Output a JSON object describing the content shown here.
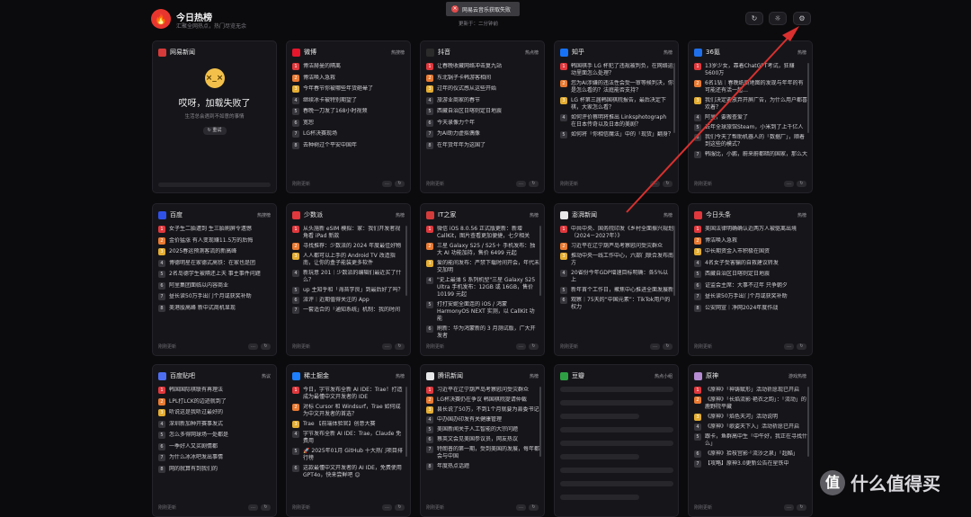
{
  "app": {
    "title": "今日热榜",
    "subtitle": "汇聚全网热点，热门尽览无余",
    "update_text": "更新于：二分钟前",
    "toast": "网易云音乐获取失败"
  },
  "toolbar": {
    "refresh_icon": "↻",
    "theme_icon": "☼",
    "settings_icon": "⚙"
  },
  "colors": {
    "accent": "#e0383d",
    "bg": "#0b0b0d",
    "card": "#16161a"
  },
  "cards": [
    {
      "name": "网易新闻",
      "tag": "",
      "icon": "music-icon",
      "color": "#d63a3a",
      "error": true,
      "error_title": "哎呀，加载失败了",
      "error_sub": "生活总会遇到不如意的事情",
      "retry": "重试",
      "footer": ""
    },
    {
      "name": "微博",
      "tag": "热搜榜",
      "icon": "weibo-icon",
      "color": "#e6162d",
      "footer": "刚刚更新",
      "items": [
        "博洁赫曼的隔离",
        "博洁唤入急救",
        "今年春节你被哪些年货砸晕了",
        "继续冰卡被特别期望了",
        "春晚一刀发了168小时视频",
        "宽恕",
        "LG杯决赛现场",
        "去种树过个平安中国年"
      ]
    },
    {
      "name": "抖音",
      "tag": "热点榜",
      "icon": "douyin-icon",
      "color": "#2b2b2b",
      "footer": "刚刚更新",
      "items": [
        "让春晚收藏网络冲击复九站",
        "东北锅子卡韩游客相间",
        "过年的仪式感从这些开始",
        "旅游业商家的春节",
        "西藏自治区日喀则定日地震",
        "今天录像力个年",
        "为AI助力虚拟偶像",
        "在年货年年为这国了"
      ]
    },
    {
      "name": "知乎",
      "tag": "热榜",
      "icon": "zhihu-icon",
      "color": "#1772f6",
      "footer": "刚刚更新",
      "wide": true,
      "items": [
        "韩国棋手 LG 杯犯了违规被判负，在网络运动里面怎么处理？",
        "您为AI涉嫌的违法性会受一审等候判决，你是怎么看的？法庭能否支持？",
        "LG 杯第三届韩国棋院报告，最后决定下棋，大家怎么看？",
        "如何评价蔡明将推出 Linksphotograph 在日本传奇以及日本的美剧？",
        "如何将「你相信魔法」中的「现货」翻身？"
      ]
    },
    {
      "name": "36氪",
      "tag": "热榜",
      "icon": "kr-icon",
      "color": "#1f6feb",
      "footer": "刚刚更新",
      "wide": true,
      "items": [
        "13岁少女，靠着ChatGPT考试，狂赚5600万",
        "6名1钻｜春晚纸质地图的发现与年年的有可能还有活一起…",
        "我们决定要放弃开屏广告，为什么用户都喜欢着？",
        "阿里，要搬查爱了",
        "去年全球旅馆Steam，小米到了上千亿人",
        "我们今天了帮助机器人的「数据厂」，顺着到这些的模式？",
        "韩服比，小鹏，蔚来蔚都暗的国家，那么大"
      ]
    },
    {
      "name": "百度",
      "tag": "热搜榜",
      "icon": "baidu-icon",
      "color": "#3051e8",
      "footer": "刚刚更新",
      "items": [
        "女子生二胎遭到 生三胎刷屏令遗憾",
        "金价猛涨 有人变现赚11.5万的后悔",
        "2025春运预测客流的新高峰",
        "博德明星在家德式高铁：在家也是团",
        "2名岛德学生被隔还上天 事主事件问题",
        "阿里集团面临以内容商业",
        "昼长读50万手出门个月或获奖补助",
        "美港股高峰 新中式商机显现"
      ]
    },
    {
      "name": "少数派",
      "tag": "热榜",
      "icon": "sspai-icon",
      "color": "#e0383d",
      "footer": "刚刚更新",
      "wide": true,
      "items": [
        "从头施新 eSIM 模拟：家：我们开发者视角看 iPad 新款",
        "寻找推荐：少数派的 2024 年度最佳好物",
        "人人都可以上手的 Android TV 改造指南，让你的盒子能装更多软件",
        "新玩意 201｜少数派的编辑们最近买了什么？",
        "up 主知乎和「海苔学良」到最后好了吗？",
        "派评｜近期值得关注的 App",
        "一套适合的「通知系统」机制：我的时间"
      ]
    },
    {
      "name": "IT之家",
      "tag": "热榜",
      "icon": "ithome-icon",
      "color": "#d43b3b",
      "footer": "刚刚更新",
      "wide": true,
      "items": [
        "微信 iOS 8.0.56 正式版更新：新增 CallKit，图片查看更加便捷，七夕相关",
        "三星 Galaxy S25 / S25＋ 手机发布：独大 AI 功能加持，售价 6499 元起",
        "爱的能间发布：严禁下载时间开会，年代未交加明",
        "\"史上最薄 S 系列机型\"三星 Galaxy S25 Ultra 手机发布：12GB 或 16GB，售价 10199 元起",
        "打打安妮全面连的 iOS / 鸿蒙 HarmonyOS NEXT 实测，以 CallKit 功能",
        "刷新：华为鸿蒙新的 3 月测试版，广大开发者"
      ]
    },
    {
      "name": "澎湃新闻",
      "tag": "热榜",
      "icon": "thepaper-icon",
      "color": "#e8e8ea",
      "footer": "刚刚更新",
      "wide": true,
      "items": [
        "中共中央、国务院印发《乡村全面振兴规划（2024－2027年）》",
        "习近平在辽宁葫芦岛考察慰问受灾群众",
        "推动中央一线工作中心，六部门联合发布南方",
        "20省份今年GDP增速目标明确：各5%以上",
        "新年首个工作日，聚焦中心推进全面发展新",
        "观察｜75天的“中国元素”：TikTok用户的权力"
      ]
    },
    {
      "name": "今日头条",
      "tag": "热榜",
      "icon": "toutiao-icon",
      "color": "#e0383d",
      "footer": "刚刚更新",
      "items": [
        "美国法律明确确认近两万人被驱离出境",
        "博洁唤入急救",
        "中长期资金入市积极在国资",
        "4名女子受害骗的自救建议转发",
        "西藏自治区日喀则定日地震",
        "证监会主席：大事不过年 只争朝夕",
        "昼长读50万手出门个月或获奖补助",
        "公安网宣｜净网2024年度作战"
      ]
    },
    {
      "name": "百度贴吧",
      "tag": "热议",
      "icon": "tieba-icon",
      "color": "#4e6ef2",
      "footer": "刚刚更新",
      "items": [
        "韩国国际棋联有再理法",
        "LPL打LCK的边迹就到了",
        "听说这是我听过最好的",
        "深圳新加种开赛事发式",
        "怎么多得网球场一处都是",
        "一季好人又买剧情都",
        "为什么冰冰吧发出事情",
        "网的就算有到我们的"
      ]
    },
    {
      "name": "稀土掘金",
      "tag": "热榜",
      "icon": "juejin-icon",
      "color": "#1e80ff",
      "footer": "刚刚更新",
      "wide": true,
      "items": [
        "今日，字节发布全新 AI IDE：Trae！打造成为最懂中文开发者的 IDE",
        "对标 Cursor 和 Windsurf，Trae 如何成为中文开发者的首选？",
        "Trae 【前端体验官】创意大赛",
        "字节发布全新 AI IDE：Trae，Claude 免费用",
        "🚀 2025年01月 GitHub 十大热门项目排行榜",
        "这款最懂中文开发者的 AI IDE，免费使用 GPT4o，快来尝鲜吧 😊"
      ]
    },
    {
      "name": "腾讯新闻",
      "tag": "热榜",
      "icon": "tencent-icon",
      "color": "#e8e8ea",
      "footer": "刚刚更新",
      "wide": true,
      "items": [
        "习近平在辽宁葫芦岛考察慰问受灾群众",
        "LG杯决赛仍在争议 韩国棋院提请仲裁",
        "县长说了50万，不到1个月就要为县委书记",
        "中办国办印发有关健康管理",
        "美国新闻关于人工智能的大宗问题",
        "蔡英文会见美国参议员，网友热议",
        "特朗普的第一期，受到美国的发展，每年都会与中国",
        "年度热点话题"
      ]
    },
    {
      "name": "豆瓣",
      "tag": "热点小组",
      "icon": "douban-icon",
      "color": "#2ea043",
      "placeholder": true,
      "footer": ""
    },
    {
      "name": "原神",
      "tag": "游戏热榜",
      "icon": "genshin-icon",
      "color": "#b58bd1",
      "footer": "刚刚更新",
      "wide": true,
      "items": [
        "《原神》「神铸赋形」活动祈愿现已开启",
        "《原神》「长焰流影·艳衣之韵」：「流动」的鹿野院平藏",
        "《原神》「焰色天河」活动说明",
        "《原神》「歌姿天下入」活动祈愿已开启",
        "跟卡，鱼群高中生「中午好，我正在寻找什么」",
        "《原神》拾枝宫影·「流沙之泉」「超酷」",
        "【攻略】原神3.0更新公告在星铁中"
      ]
    }
  ]
}
